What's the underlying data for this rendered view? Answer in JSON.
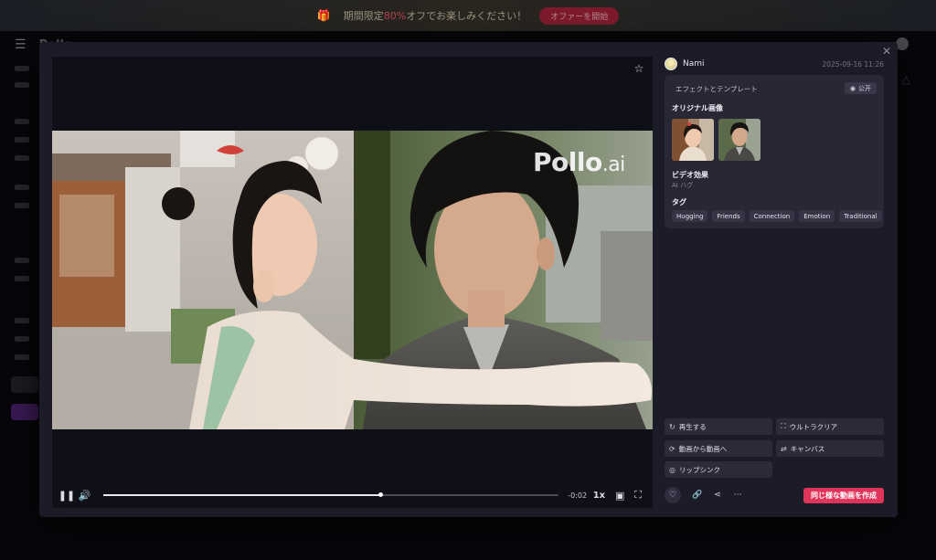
{
  "promo": {
    "text_before": "期間限定",
    "highlight": "80%",
    "text_after": "オフでお楽しみください！",
    "button_label": "オファーを開始"
  },
  "app": {
    "logo": "Pollo"
  },
  "modal": {
    "user": {
      "name": "Nami",
      "date": "2025-09-16 11:26"
    },
    "video": {
      "watermark_brand": "Pollo",
      "watermark_suffix": ".ai",
      "time_remaining": "-0:02",
      "speed": "1x",
      "progress": 0.61
    },
    "info": {
      "card_title": "エフェクトとテンプレート",
      "public_label": "公开",
      "original_images_label": "オリジナル画像",
      "video_effect_label": "ビデオ効果",
      "video_effect_value": "AI ハグ",
      "tags_label": "タグ",
      "tags": [
        "Hugging",
        "Friends",
        "Connection",
        "Emotion",
        "Traditional"
      ]
    },
    "actions": {
      "replay": "再生する",
      "ultra_clear": "ウルトラクリア",
      "video_to_video": "動画から動画へ",
      "canvas": "キャンバス",
      "lip_sync": "リップシンク",
      "create_similar": "同じ様な動画を作成"
    },
    "colors": {
      "accent": "#e0345a",
      "panel": "#1c1c28",
      "card": "#272736"
    }
  }
}
